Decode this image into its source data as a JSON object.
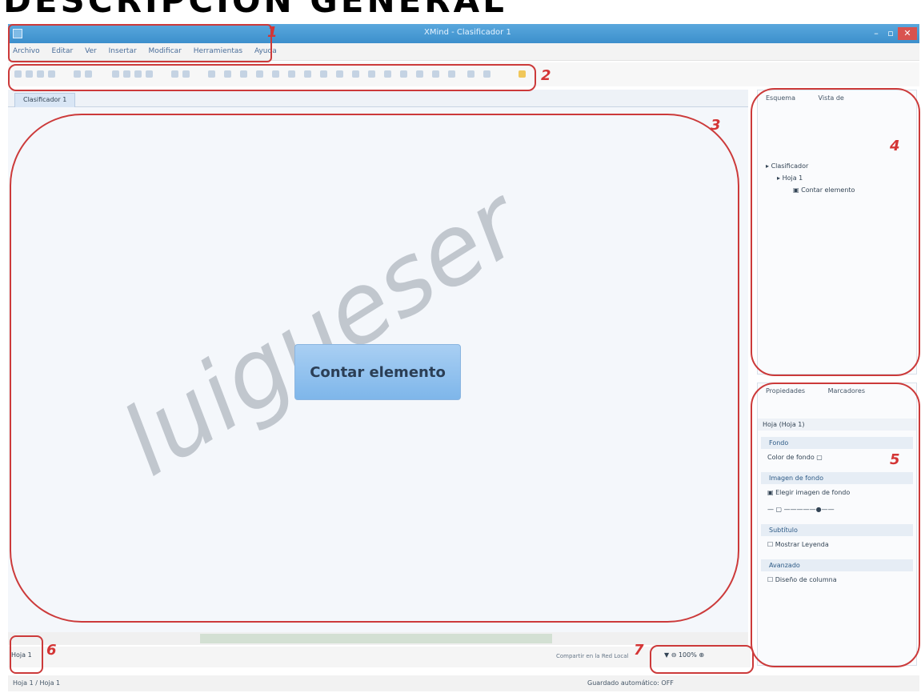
{
  "page_heading": "DESCRIPCIÓN GENERAL",
  "window": {
    "title": "XMind - Clasificador 1"
  },
  "menu": [
    "Archivo",
    "Editar",
    "Ver",
    "Insertar",
    "Modificar",
    "Herramientas",
    "Ayuda"
  ],
  "editor_tab": "Clasificador 1",
  "canvas": {
    "central_node": "Contar elemento",
    "watermark": "luigueser"
  },
  "outline_panel": {
    "tabs": [
      "Esquema",
      "Vista de"
    ],
    "tree": [
      "Clasificador",
      "Hoja 1",
      "Contar elemento"
    ]
  },
  "properties_panel": {
    "tabs": [
      "Propiedades",
      "Marcadores"
    ],
    "title": "Hoja (Hoja 1)",
    "sections": [
      {
        "header": "Fondo",
        "rows": [
          "Color de fondo"
        ]
      },
      {
        "header": "Imagen de fondo",
        "rows": [
          "Elegir imagen de fondo",
          ""
        ]
      },
      {
        "header": "Subtítulo",
        "rows": [
          "Mostrar Leyenda"
        ]
      },
      {
        "header": "Avanzado",
        "rows": [
          "Diseño de columna"
        ]
      }
    ]
  },
  "bottom": {
    "sheet_tab": "Hoja 1",
    "zoom_label": "Compartir en la Red Local",
    "zoom_value": "100%"
  },
  "status": {
    "left": "Hoja 1 / Hoja 1",
    "right": "Guardado automático: OFF"
  },
  "annotations": [
    "1",
    "2",
    "3",
    "4",
    "5",
    "6",
    "7"
  ]
}
